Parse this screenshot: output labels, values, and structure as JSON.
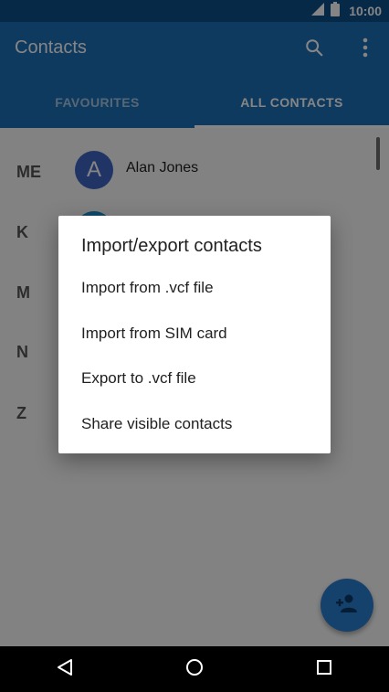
{
  "status_bar": {
    "time": "10:00"
  },
  "app_bar": {
    "title": "Contacts"
  },
  "tabs": [
    {
      "label": "FAVOURITES",
      "active": false
    },
    {
      "label": "ALL CONTACTS",
      "active": true
    }
  ],
  "list": {
    "me_label": "ME",
    "me_contact": {
      "initial": "A",
      "name": "Alan Jones"
    },
    "section_letters": [
      "K",
      "M",
      "N",
      "Z"
    ]
  },
  "dialog": {
    "title": "Import/export contacts",
    "options": [
      "Import from .vcf file",
      "Import from SIM card",
      "Export to .vcf file",
      "Share visible contacts"
    ]
  },
  "icons": {
    "search": "search-icon",
    "overflow": "more-vert-icon",
    "fab": "add-person-icon",
    "nav_back": "back-icon",
    "nav_home": "home-icon",
    "nav_recents": "recents-icon"
  },
  "colors": {
    "status_bar": "#0d4f88",
    "primary": "#1e6fb7",
    "accent": "#2a7dd1",
    "avatar": "#3f66c2"
  }
}
